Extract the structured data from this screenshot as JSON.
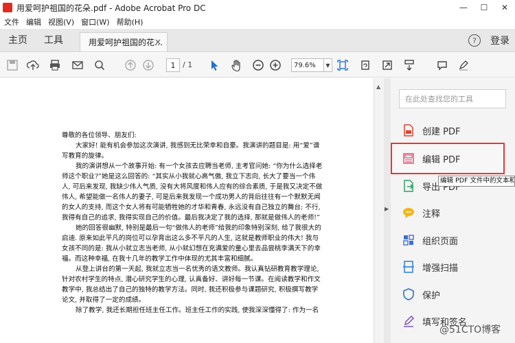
{
  "window": {
    "title": "用爱呵护祖国的花朵.pdf - Adobe Acrobat Pro DC",
    "minimize": "—",
    "maximize": "☐",
    "close": "✕"
  },
  "menu": [
    "文件",
    "编辑",
    "视图(V)",
    "窗口(W)",
    "帮助(H)"
  ],
  "tabs": {
    "home": "主页",
    "tools": "工具",
    "document": "用爱呵护祖国的花…",
    "close": "×",
    "help": "?",
    "login": "登录"
  },
  "toolbar": {
    "page_current": "1",
    "page_total": "/ 1",
    "zoom": "79.6%",
    "zoom_arrow": "▼",
    "icons": [
      "save-icon",
      "upload-icon",
      "print-icon",
      "email-icon",
      "search-icon",
      "page-up-icon",
      "page-down-icon",
      "select-cursor-icon",
      "hand-icon",
      "zoom-out-icon",
      "zoom-in-icon",
      "fit-page-icon",
      "rotate-icon",
      "fullscreen-icon",
      "scroll-icon",
      "comment-icon",
      "highlight-icon"
    ]
  },
  "document": {
    "paragraphs": [
      "尊敬的各位领导、朋友们:",
      "大家好! 能有机会参加这次演讲, 我感到无比荣幸和自豪。我演讲的题目是: 用“爱”谱写教育的旋律。",
      "我的演讲想从一个故事开始: 有一个女孩去应聘当老师, 主考官问她: “你为什么选择老师这个职业?”她是这么回答的: “其实从小我就心高气傲, 我立下志向, 长大了要当一个伟人, 可后来发现, 我缺少伟人气质, 没有大将风度和伟人应有的综合素质, 于是我又决定不做伟人, 希望能做一名伟人的妻子, 可是后来我发现一个成功男人的背后往往有一个默默无闻的女人的支持, 而这个女人将有可能牺牲她的才华和青春, 永远没有自己独立的舞台; 不行, 我得有自己的追求, 我得实现自己的价值。最后我决定了我的选择, 那就是做伟人的老师!”",
      "她的回答很幽默, 特别是最后一句“做伟人的老师”给我的印象特别深刻, 给了我很大的启迪. 原来如此平凡的岗位可以孕育出这么多不平凡的人生, 这就是教师职业的伟大! 我与女孩不同的是: 我从小就立志当老师, 从小就幻想在充满爱的童心里去品尝桃李满天下的幸福。而这种幸福, 在我十几年的教学工作中体现的尤其丰富和细腻。",
      "从登上讲台的第一天起, 我就立志当一名优秀的语文教师。我认真钻研教育教学理论, 针对农村学生的特点, 潜心研究学生的心理, 认真备好、讲好每一节课。在阅读教学和作文教学中, 我总结出了自己的独特的教学方法。同时, 我还积极参与课题研究, 积极撰写教学论文, 并取得了一定的成绩。",
      "除了教学, 我还长期担任班主任工作。班主任工作的实践, 使我深深懂得了: 作为一名"
    ]
  },
  "right_panel": {
    "search_placeholder": "在此处查找您的工具",
    "tools": [
      {
        "label": "创建 PDF",
        "icon": "create-pdf-icon",
        "color": "#e0412c"
      },
      {
        "label": "编辑 PDF",
        "icon": "edit-pdf-icon",
        "color": "#e0567a"
      },
      {
        "label": "导出 PDF",
        "icon": "export-pdf-icon",
        "color": "#2c9e63"
      },
      {
        "label": "注释",
        "icon": "comment-icon",
        "color": "#f2b619"
      },
      {
        "label": "组织页面",
        "icon": "organize-pages-icon",
        "color": "#3f6fd1"
      },
      {
        "label": "增强扫描",
        "icon": "enhance-scan-icon",
        "color": "#2d7fd6"
      },
      {
        "label": "保护",
        "icon": "protect-icon",
        "color": "#2d6fc9"
      },
      {
        "label": "填写和签名",
        "icon": "fill-sign-icon",
        "color": "#7a4bbf"
      }
    ],
    "tooltip": "编辑 PDF 文件中的文本和图",
    "highlight_color": "#e33333"
  },
  "watermark": "@51CTO博客"
}
